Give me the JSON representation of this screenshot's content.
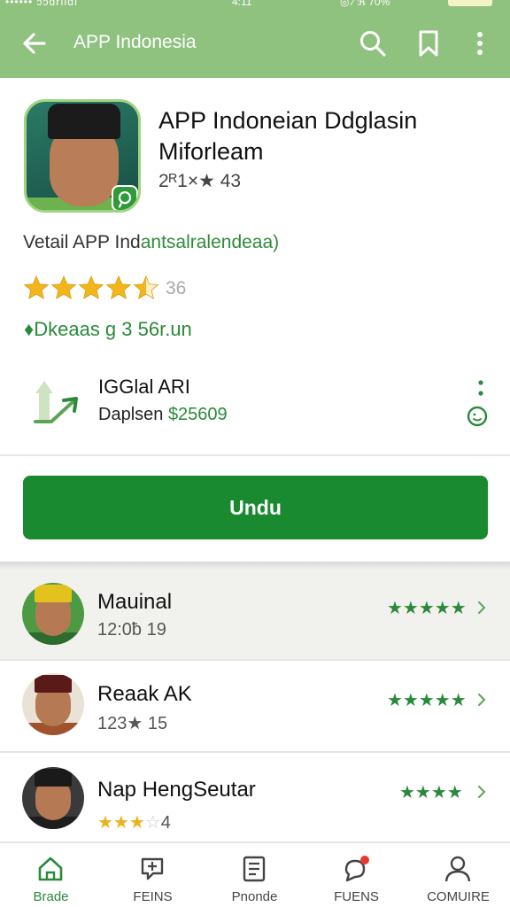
{
  "statusbar": {
    "left": "•••••• ɔɔɑrılɑı",
    "middle": "4:11",
    "right": "◎ ⁄ ℜ 70%"
  },
  "appbar": {
    "title": "APP Indonesia",
    "icons": [
      "back-arrow-icon",
      "search-icon",
      "bookmark-icon",
      "more-vert-icon"
    ],
    "color": "#8fc27f"
  },
  "app": {
    "name_line1": "APP Indoneian Ddglasin",
    "name_line2": "Miforleam",
    "meta": "2ᴿ1×★ 43",
    "subtitle_prefix": "Vetail APP Ind",
    "subtitle_highlight": "antsalralendeaa)",
    "rating_stars": 4.5,
    "rating_count": "36",
    "downloads": "♦Dkeaas g 3 56r.un"
  },
  "developer": {
    "name": "IGGlal ARI",
    "price_prefix": "Daplsen ",
    "price_value": "$25609"
  },
  "install": {
    "label": "Undu",
    "color": "#1a8a30"
  },
  "reviews": [
    {
      "name": "Mauinal",
      "sub": "12:0ƀ 19",
      "stars_text": "★★★★★",
      "highlighted": true
    },
    {
      "name": "Reaak AK",
      "sub": "123★ 15",
      "stars_text": "★★★★★",
      "highlighted": false
    },
    {
      "name": "Nap HengSeutar",
      "sub_stars_filled": "★★★",
      "sub_stars_empty": "☆",
      "sub_num": "4",
      "stars_text": "★★★★",
      "highlighted": false
    }
  ],
  "bottom_nav": [
    {
      "label": "Brade",
      "icon": "home-icon",
      "active": true
    },
    {
      "label": "FEINS",
      "icon": "flag-icon",
      "active": false
    },
    {
      "label": "Pnonde",
      "icon": "document-icon",
      "active": false
    },
    {
      "label": "FUENS",
      "icon": "chat-bubble-icon",
      "active": false
    },
    {
      "label": "COMUIRE",
      "icon": "person-icon",
      "active": false
    }
  ],
  "colors": {
    "accent_green": "#2a8a3a",
    "star_gold": "#e9b320"
  }
}
